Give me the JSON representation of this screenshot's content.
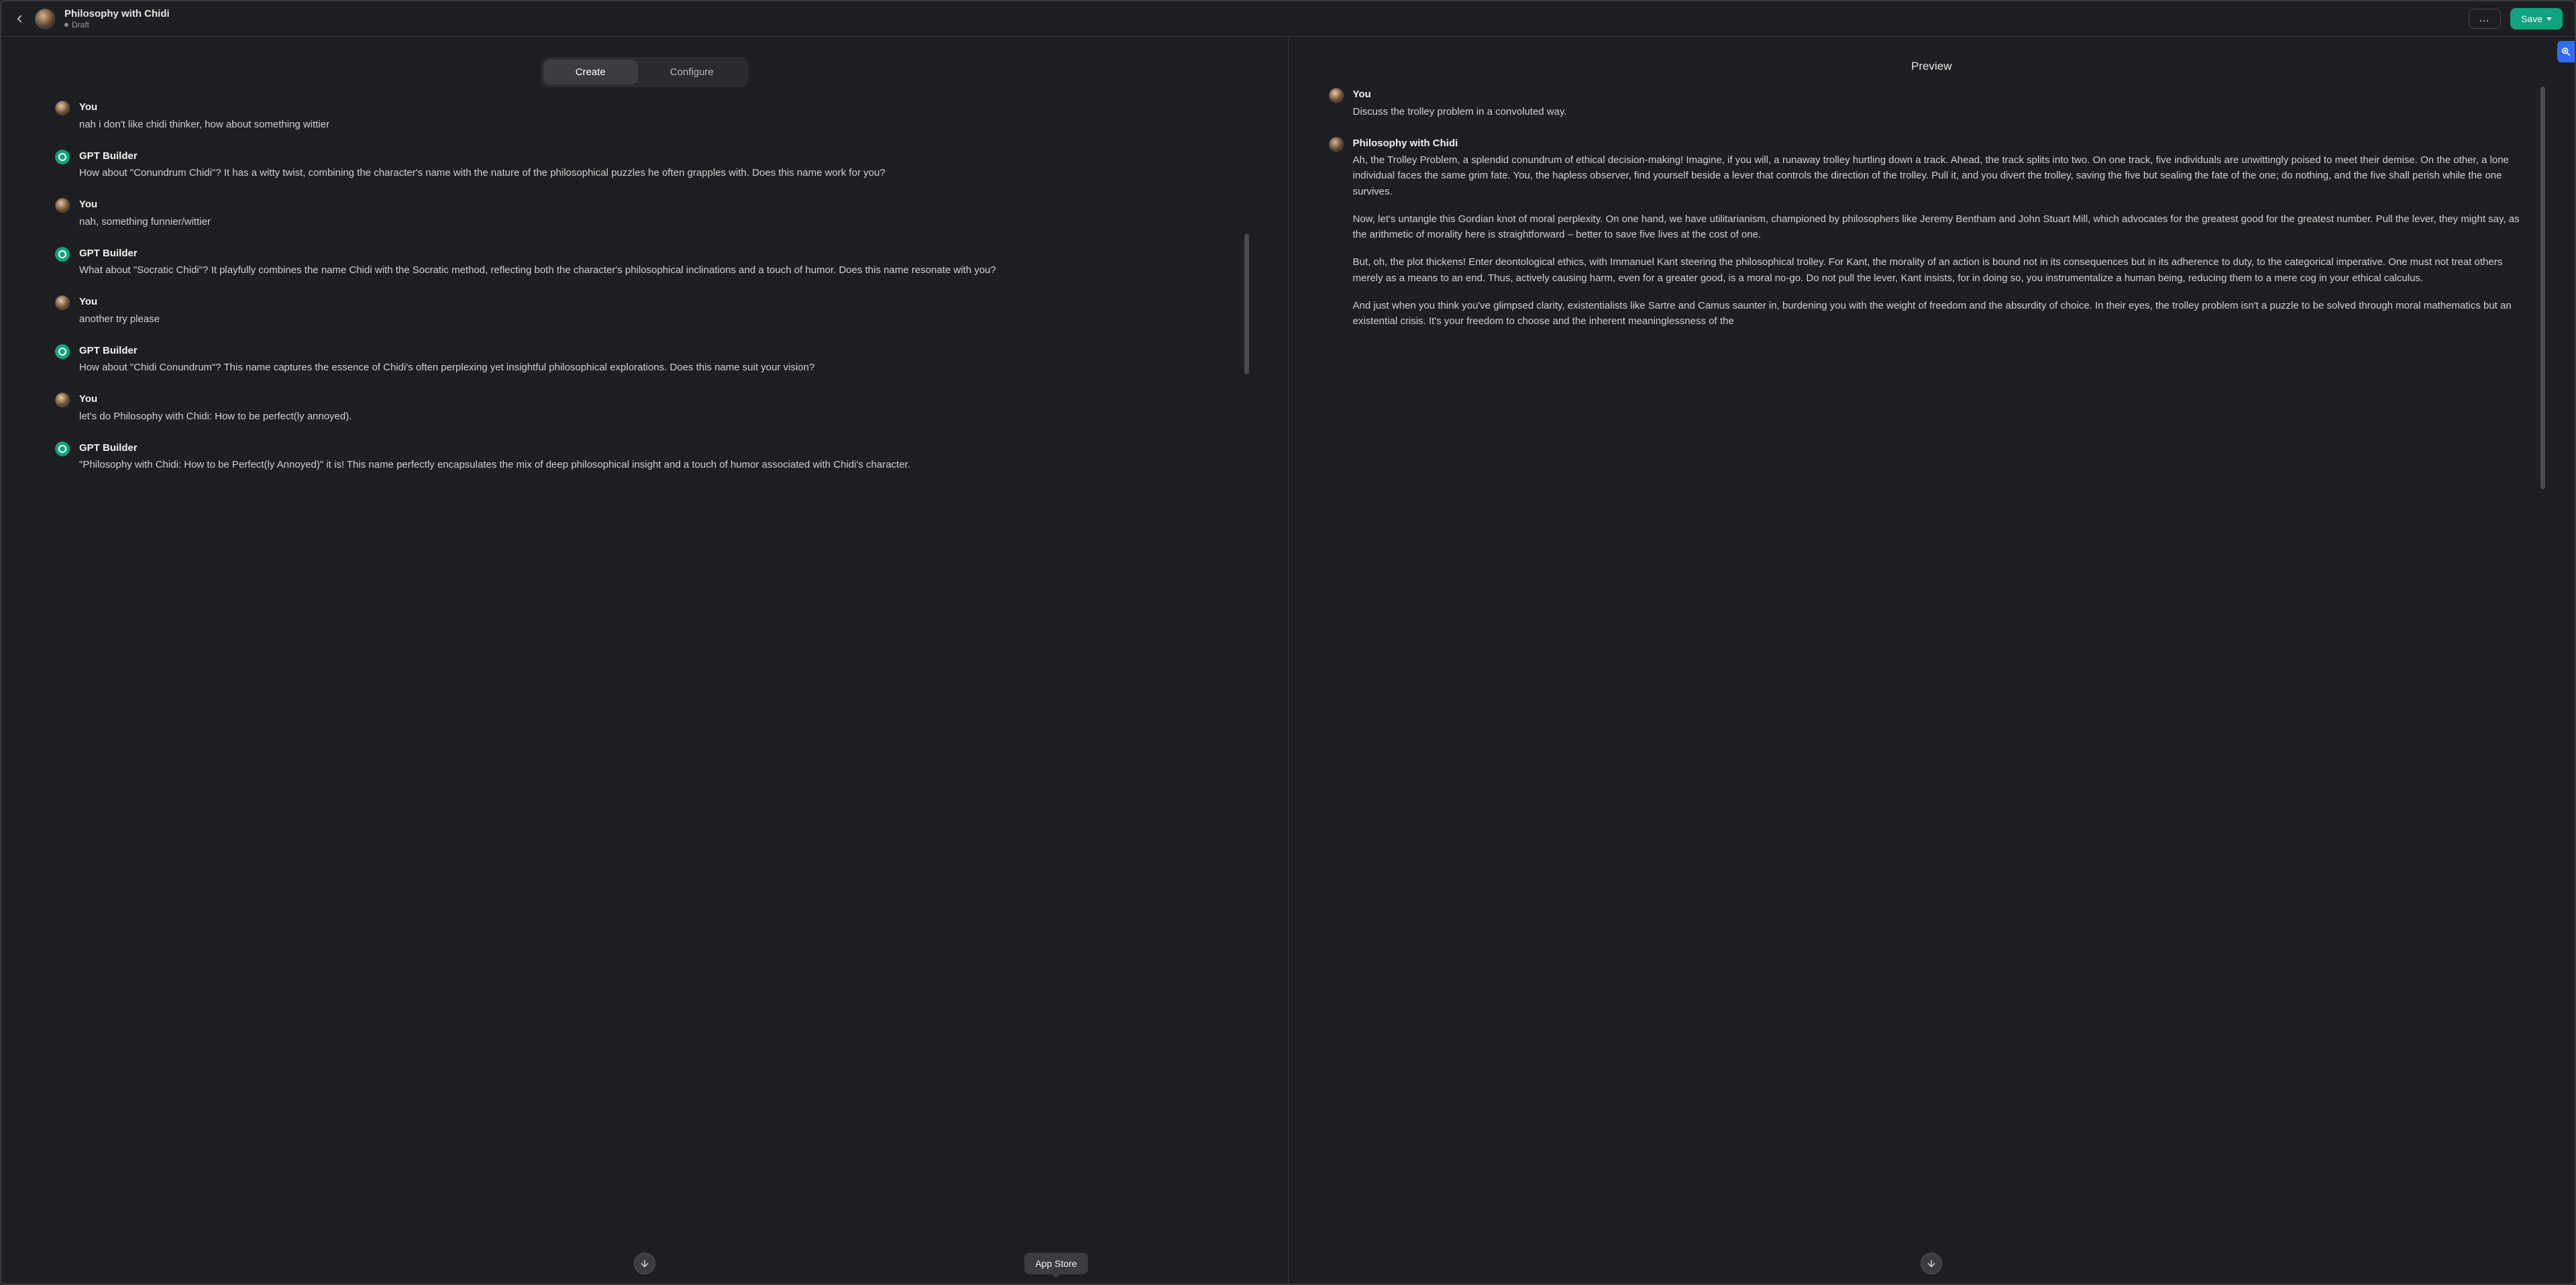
{
  "header": {
    "title": "Philosophy with Chidi",
    "status": "Draft",
    "more_label": "…",
    "save_label": "Save"
  },
  "left": {
    "tabs": {
      "create": "Create",
      "configure": "Configure"
    },
    "messages": [
      {
        "role": "user",
        "name": "You",
        "text": "nah i don't like chidi thinker, how about something wittier"
      },
      {
        "role": "gpt",
        "name": "GPT Builder",
        "text": "How about \"Conundrum Chidi\"? It has a witty twist, combining the character's name with the nature of the philosophical puzzles he often grapples with. Does this name work for you?"
      },
      {
        "role": "user",
        "name": "You",
        "text": "nah, something funnier/wittier"
      },
      {
        "role": "gpt",
        "name": "GPT Builder",
        "text": "What about \"Socratic Chidi\"? It playfully combines the name Chidi with the Socratic method, reflecting both the character's philosophical inclinations and a touch of humor. Does this name resonate with you?"
      },
      {
        "role": "user",
        "name": "You",
        "text": "another try please"
      },
      {
        "role": "gpt",
        "name": "GPT Builder",
        "text": "How about \"Chidi Conundrum\"? This name captures the essence of Chidi's often perplexing yet insightful philosophical explorations. Does this name suit your vision?"
      },
      {
        "role": "user",
        "name": "You",
        "text": "let's do Philosophy with Chidi: How to be perfect(ly annoyed)."
      },
      {
        "role": "gpt",
        "name": "GPT Builder",
        "text": "\"Philosophy with Chidi: How to be Perfect(ly Annoyed)\" it is! This name perfectly encapsulates the mix of deep philosophical insight and a touch of humor associated with Chidi's character."
      }
    ],
    "tooltip": "App Store"
  },
  "right": {
    "title": "Preview",
    "messages": [
      {
        "role": "user",
        "name": "You",
        "paragraphs": [
          "Discuss the trolley problem in a convoluted way."
        ]
      },
      {
        "role": "persona",
        "name": "Philosophy with Chidi",
        "paragraphs": [
          "Ah, the Trolley Problem, a splendid conundrum of ethical decision-making! Imagine, if you will, a runaway trolley hurtling down a track. Ahead, the track splits into two. On one track, five individuals are unwittingly poised to meet their demise. On the other, a lone individual faces the same grim fate. You, the hapless observer, find yourself beside a lever that controls the direction of the trolley. Pull it, and you divert the trolley, saving the five but sealing the fate of the one; do nothing, and the five shall perish while the one survives.",
          "Now, let's untangle this Gordian knot of moral perplexity. On one hand, we have utilitarianism, championed by philosophers like Jeremy Bentham and John Stuart Mill, which advocates for the greatest good for the greatest number. Pull the lever, they might say, as the arithmetic of morality here is straightforward – better to save five lives at the cost of one.",
          "But, oh, the plot thickens! Enter deontological ethics, with Immanuel Kant steering the philosophical trolley. For Kant, the morality of an action is bound not in its consequences but in its adherence to duty, to the categorical imperative. One must not treat others merely as a means to an end. Thus, actively causing harm, even for a greater good, is a moral no-go. Do not pull the lever, Kant insists, for in doing so, you instrumentalize a human being, reducing them to a mere cog in your ethical calculus.",
          "And just when you think you've glimpsed clarity, existentialists like Sartre and Camus saunter in, burdening you with the weight of freedom and the absurdity of choice. In their eyes, the trolley problem isn't a puzzle to be solved through moral mathematics but an existential crisis. It's your freedom to choose and the inherent meaninglessness of the"
        ]
      }
    ]
  }
}
